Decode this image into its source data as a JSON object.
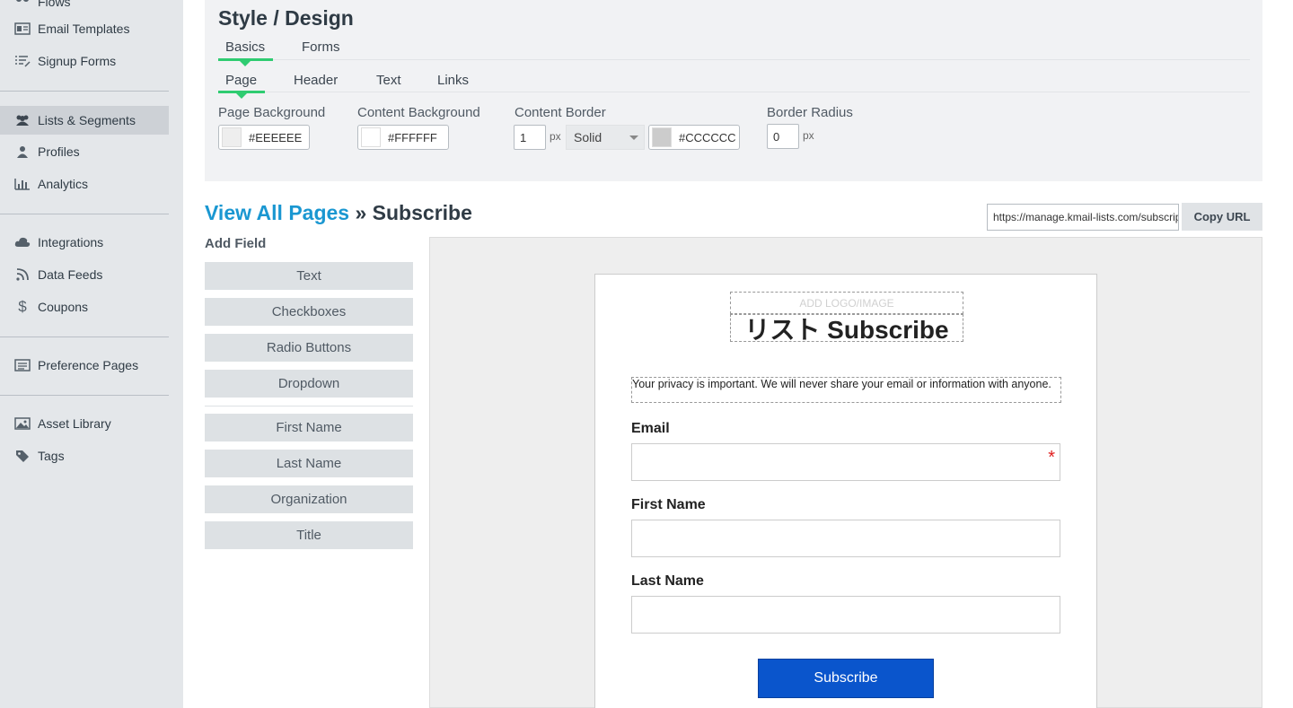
{
  "sidebar": {
    "items": [
      {
        "label": "Flows",
        "icon": "flows-icon"
      },
      {
        "label": "Email Templates",
        "icon": "email-template-icon"
      },
      {
        "label": "Signup Forms",
        "icon": "signup-forms-icon"
      },
      {
        "label": "Lists & Segments",
        "icon": "users-icon",
        "active": true
      },
      {
        "label": "Profiles",
        "icon": "person-icon"
      },
      {
        "label": "Analytics",
        "icon": "bar-chart-icon"
      },
      {
        "label": "Integrations",
        "icon": "cloud-icon"
      },
      {
        "label": "Data Feeds",
        "icon": "rss-icon"
      },
      {
        "label": "Coupons",
        "icon": "dollar-icon"
      },
      {
        "label": "Preference Pages",
        "icon": "list-page-icon"
      },
      {
        "label": "Asset Library",
        "icon": "image-icon"
      },
      {
        "label": "Tags",
        "icon": "tag-icon"
      }
    ]
  },
  "design": {
    "title": "Style / Design",
    "tabs": [
      "Basics",
      "Forms"
    ],
    "active_tab": "Basics",
    "subtabs": [
      "Page",
      "Header",
      "Text",
      "Links"
    ],
    "active_subtab": "Page",
    "page_background_label": "Page Background",
    "page_background_value": "#EEEEEE",
    "content_background_label": "Content Background",
    "content_background_value": "#FFFFFF",
    "content_border_label": "Content Border",
    "content_border_width": "1",
    "content_border_unit": "px",
    "content_border_style": "Solid",
    "content_border_color": "#CCCCCC",
    "border_radius_label": "Border Radius",
    "border_radius_value": "0",
    "border_radius_unit": "px"
  },
  "breadcrumb": {
    "link": "View All Pages",
    "separator": "»",
    "current": "Subscribe"
  },
  "url_bar": {
    "value": "https://manage.kmail-lists.com/subscriptions/subscribe",
    "copy_label": "Copy URL"
  },
  "add_field": {
    "title": "Add Field",
    "group1": [
      "Text",
      "Checkboxes",
      "Radio Buttons",
      "Dropdown"
    ],
    "group2": [
      "First Name",
      "Last Name",
      "Organization",
      "Title"
    ]
  },
  "preview": {
    "logo_placeholder": "ADD LOGO/IMAGE",
    "heading": "リスト Subscribe",
    "privacy": "Your privacy is important. We will never share your email or information with anyone.",
    "fields": [
      {
        "label": "Email",
        "required": true
      },
      {
        "label": "First Name",
        "required": false
      },
      {
        "label": "Last Name",
        "required": false
      }
    ],
    "required_mark": "*",
    "submit_label": "Subscribe",
    "accent": "#0a55cc"
  },
  "colors": {
    "tab_underline": "#2fcc71",
    "link": "#1a97d1",
    "sidebar_bg": "#e4e7ea"
  }
}
